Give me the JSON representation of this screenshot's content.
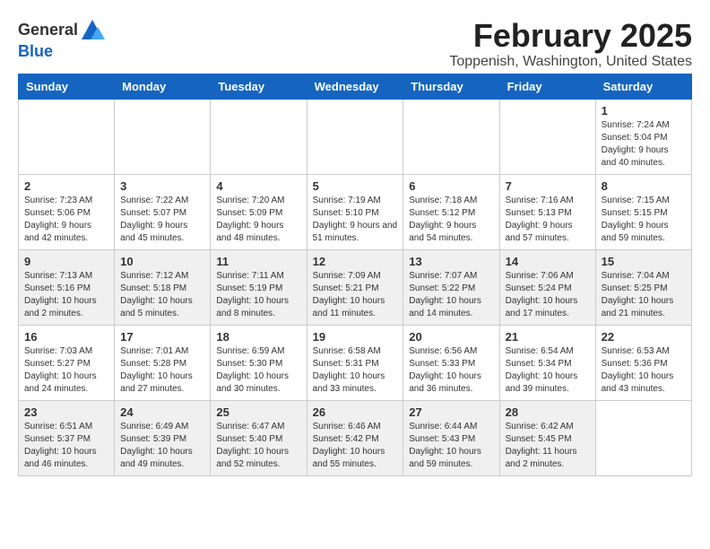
{
  "header": {
    "logo_line1": "General",
    "logo_line2": "Blue",
    "month_title": "February 2025",
    "location": "Toppenish, Washington, United States"
  },
  "columns": [
    "Sunday",
    "Monday",
    "Tuesday",
    "Wednesday",
    "Thursday",
    "Friday",
    "Saturday"
  ],
  "weeks": [
    {
      "days": [
        {
          "num": "",
          "info": ""
        },
        {
          "num": "",
          "info": ""
        },
        {
          "num": "",
          "info": ""
        },
        {
          "num": "",
          "info": ""
        },
        {
          "num": "",
          "info": ""
        },
        {
          "num": "",
          "info": ""
        },
        {
          "num": "1",
          "info": "Sunrise: 7:24 AM\nSunset: 5:04 PM\nDaylight: 9 hours and 40 minutes."
        }
      ]
    },
    {
      "days": [
        {
          "num": "2",
          "info": "Sunrise: 7:23 AM\nSunset: 5:06 PM\nDaylight: 9 hours and 42 minutes."
        },
        {
          "num": "3",
          "info": "Sunrise: 7:22 AM\nSunset: 5:07 PM\nDaylight: 9 hours and 45 minutes."
        },
        {
          "num": "4",
          "info": "Sunrise: 7:20 AM\nSunset: 5:09 PM\nDaylight: 9 hours and 48 minutes."
        },
        {
          "num": "5",
          "info": "Sunrise: 7:19 AM\nSunset: 5:10 PM\nDaylight: 9 hours and 51 minutes."
        },
        {
          "num": "6",
          "info": "Sunrise: 7:18 AM\nSunset: 5:12 PM\nDaylight: 9 hours and 54 minutes."
        },
        {
          "num": "7",
          "info": "Sunrise: 7:16 AM\nSunset: 5:13 PM\nDaylight: 9 hours and 57 minutes."
        },
        {
          "num": "8",
          "info": "Sunrise: 7:15 AM\nSunset: 5:15 PM\nDaylight: 9 hours and 59 minutes."
        }
      ]
    },
    {
      "days": [
        {
          "num": "9",
          "info": "Sunrise: 7:13 AM\nSunset: 5:16 PM\nDaylight: 10 hours and 2 minutes."
        },
        {
          "num": "10",
          "info": "Sunrise: 7:12 AM\nSunset: 5:18 PM\nDaylight: 10 hours and 5 minutes."
        },
        {
          "num": "11",
          "info": "Sunrise: 7:11 AM\nSunset: 5:19 PM\nDaylight: 10 hours and 8 minutes."
        },
        {
          "num": "12",
          "info": "Sunrise: 7:09 AM\nSunset: 5:21 PM\nDaylight: 10 hours and 11 minutes."
        },
        {
          "num": "13",
          "info": "Sunrise: 7:07 AM\nSunset: 5:22 PM\nDaylight: 10 hours and 14 minutes."
        },
        {
          "num": "14",
          "info": "Sunrise: 7:06 AM\nSunset: 5:24 PM\nDaylight: 10 hours and 17 minutes."
        },
        {
          "num": "15",
          "info": "Sunrise: 7:04 AM\nSunset: 5:25 PM\nDaylight: 10 hours and 21 minutes."
        }
      ]
    },
    {
      "days": [
        {
          "num": "16",
          "info": "Sunrise: 7:03 AM\nSunset: 5:27 PM\nDaylight: 10 hours and 24 minutes."
        },
        {
          "num": "17",
          "info": "Sunrise: 7:01 AM\nSunset: 5:28 PM\nDaylight: 10 hours and 27 minutes."
        },
        {
          "num": "18",
          "info": "Sunrise: 6:59 AM\nSunset: 5:30 PM\nDaylight: 10 hours and 30 minutes."
        },
        {
          "num": "19",
          "info": "Sunrise: 6:58 AM\nSunset: 5:31 PM\nDaylight: 10 hours and 33 minutes."
        },
        {
          "num": "20",
          "info": "Sunrise: 6:56 AM\nSunset: 5:33 PM\nDaylight: 10 hours and 36 minutes."
        },
        {
          "num": "21",
          "info": "Sunrise: 6:54 AM\nSunset: 5:34 PM\nDaylight: 10 hours and 39 minutes."
        },
        {
          "num": "22",
          "info": "Sunrise: 6:53 AM\nSunset: 5:36 PM\nDaylight: 10 hours and 43 minutes."
        }
      ]
    },
    {
      "days": [
        {
          "num": "23",
          "info": "Sunrise: 6:51 AM\nSunset: 5:37 PM\nDaylight: 10 hours and 46 minutes."
        },
        {
          "num": "24",
          "info": "Sunrise: 6:49 AM\nSunset: 5:39 PM\nDaylight: 10 hours and 49 minutes."
        },
        {
          "num": "25",
          "info": "Sunrise: 6:47 AM\nSunset: 5:40 PM\nDaylight: 10 hours and 52 minutes."
        },
        {
          "num": "26",
          "info": "Sunrise: 6:46 AM\nSunset: 5:42 PM\nDaylight: 10 hours and 55 minutes."
        },
        {
          "num": "27",
          "info": "Sunrise: 6:44 AM\nSunset: 5:43 PM\nDaylight: 10 hours and 59 minutes."
        },
        {
          "num": "28",
          "info": "Sunrise: 6:42 AM\nSunset: 5:45 PM\nDaylight: 11 hours and 2 minutes."
        },
        {
          "num": "",
          "info": ""
        }
      ]
    }
  ]
}
